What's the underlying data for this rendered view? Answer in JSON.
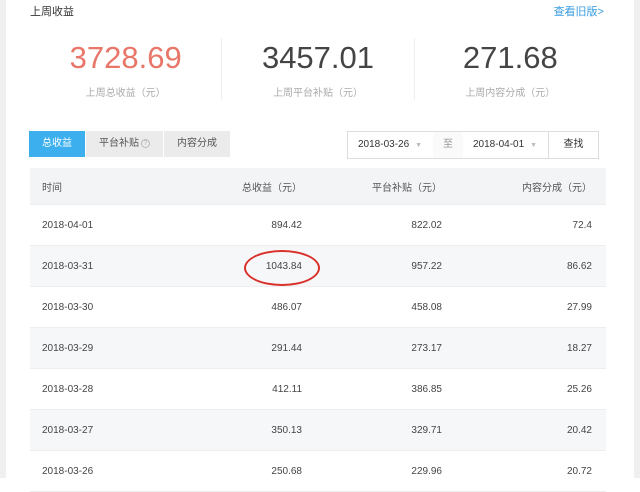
{
  "header": {
    "title": "上周收益",
    "old_version_link": "查看旧版>"
  },
  "stats": [
    {
      "value": "3728.69",
      "label": "上周总收益（元）"
    },
    {
      "value": "3457.01",
      "label": "上周平台补贴（元）"
    },
    {
      "value": "271.68",
      "label": "上周内容分成（元）"
    }
  ],
  "tabs": [
    {
      "label": "总收益"
    },
    {
      "label": "平台补贴"
    },
    {
      "label": "内容分成"
    }
  ],
  "help_icon": "?",
  "filter": {
    "start": "2018-03-26",
    "separator": "至",
    "end": "2018-04-01",
    "search_label": "查找"
  },
  "table": {
    "columns": [
      "时间",
      "总收益（元）",
      "平台补贴（元）",
      "内容分成（元）"
    ],
    "rows": [
      [
        "2018-04-01",
        "894.42",
        "822.02",
        "72.4"
      ],
      [
        "2018-03-31",
        "1043.84",
        "957.22",
        "86.62"
      ],
      [
        "2018-03-30",
        "486.07",
        "458.08",
        "27.99"
      ],
      [
        "2018-03-29",
        "291.44",
        "273.17",
        "18.27"
      ],
      [
        "2018-03-28",
        "412.11",
        "386.85",
        "25.26"
      ],
      [
        "2018-03-27",
        "350.13",
        "329.71",
        "20.42"
      ],
      [
        "2018-03-26",
        "250.68",
        "229.96",
        "20.72"
      ]
    ]
  }
}
